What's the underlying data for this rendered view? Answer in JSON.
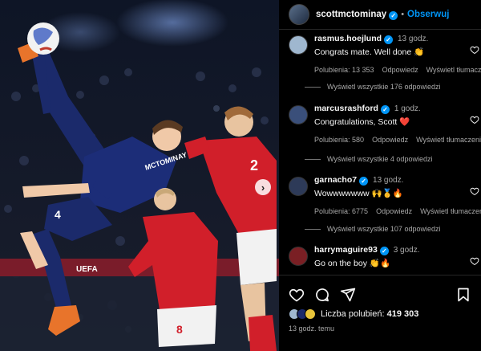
{
  "post": {
    "username": "scottmctominay",
    "follow_label": "Obserwuj",
    "separator": "•",
    "photo": {
      "player_name": "MCTOMINAY",
      "player_number": "4",
      "defender_number": "2",
      "defender2_number": "8",
      "board_text": "UEFA"
    }
  },
  "comments": [
    {
      "username": "rasmus.hoejlund",
      "time": "13 godz.",
      "text": "Congrats mate. Well done 👏",
      "likes_label": "Polubienia: 13 353",
      "reply_label": "Odpowiedz",
      "translate_label": "Wyświetl tłumaczenie",
      "view_replies": "Wyświetl wszystkie 176 odpowiedzi",
      "avatar_color": "#9fb7cf"
    },
    {
      "username": "marcusrashford",
      "time": "1 godz.",
      "text": "Congratulations, Scott ❤️",
      "likes_label": "Polubienia: 580",
      "reply_label": "Odpowiedz",
      "translate_label": "Wyświetl tłumaczenie",
      "view_replies": "Wyświetl wszystkie 4 odpowiedzi",
      "avatar_color": "#3a4f7a"
    },
    {
      "username": "garnacho7",
      "time": "13 godz.",
      "text": "Wowwwwwww 🙌🥇🔥",
      "likes_label": "Polubienia: 6775",
      "reply_label": "Odpowiedz",
      "translate_label": "Wyświetl tłumaczenie",
      "view_replies": "Wyświetl wszystkie 107 odpowiedzi",
      "avatar_color": "#2d3a58"
    },
    {
      "username": "harrymaguire93",
      "time": "3 godz.",
      "text": "Go on the boy 👏🔥",
      "likes_label": "",
      "reply_label": "",
      "translate_label": "",
      "view_replies": "",
      "avatar_color": "#7a1f24"
    }
  ],
  "actions": {
    "likes_prefix": "Liczba polubień:",
    "likes_count": "419 303",
    "posted_time": "13 godz. temu"
  },
  "colors": {
    "accent": "#0095f6",
    "heart_red": "#ff3040",
    "scotland_blue": "#1b2a6b",
    "denmark_red": "#d11f2a"
  },
  "icons": [
    "verified-badge-icon",
    "heart-icon",
    "comment-icon",
    "share-icon",
    "save-icon",
    "chevron-right-icon"
  ]
}
